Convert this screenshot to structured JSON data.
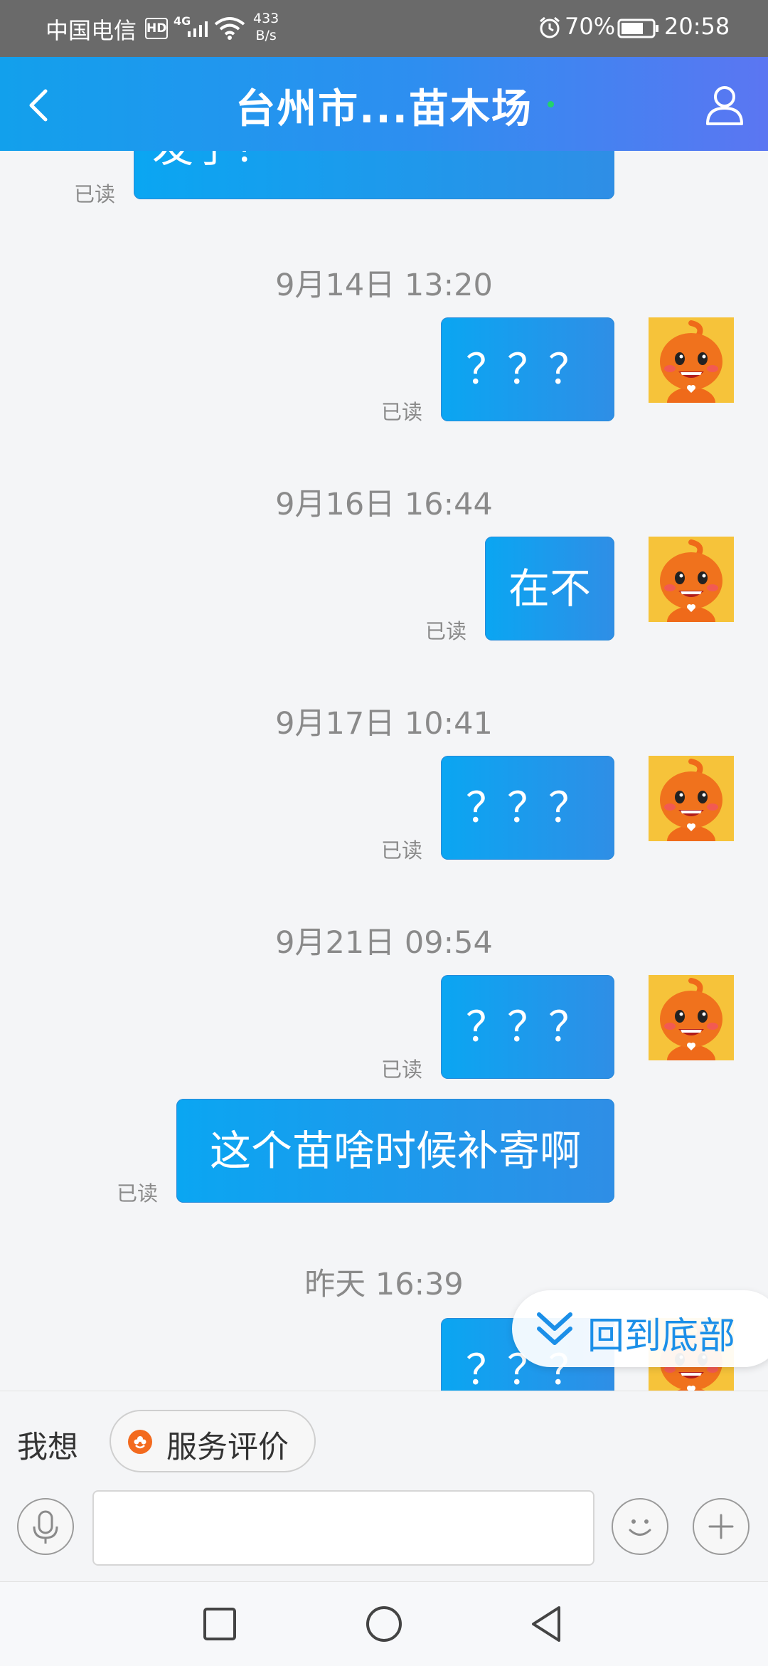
{
  "status_bar": {
    "carrier": "中国电信",
    "hd_badge": "HD",
    "network": "4G",
    "speed_value": "433",
    "speed_unit": "B/s",
    "battery_percent": "70%",
    "time": "20:58",
    "icons": [
      "signal-icon",
      "wifi-icon",
      "alarm-icon",
      "battery-icon"
    ]
  },
  "header": {
    "title": "台州市...苗木场",
    "back_icon": "chevron-left-icon",
    "profile_icon": "person-icon"
  },
  "chat": {
    "read_label": "已读",
    "messages": [
      {
        "timestamp": "",
        "text": "发了？",
        "read": "已读",
        "avatar_shown": false
      },
      {
        "timestamp": "9月14日 13:20",
        "text": "？？？",
        "read": "已读",
        "avatar_shown": true
      },
      {
        "timestamp": "9月16日 16:44",
        "text": "在不",
        "read": "已读",
        "avatar_shown": true
      },
      {
        "timestamp": "9月17日 10:41",
        "text": "？？？",
        "read": "已读",
        "avatar_shown": true
      },
      {
        "timestamp": "9月21日 09:54",
        "text": "？？？",
        "read": "已读",
        "avatar_shown": true
      },
      {
        "timestamp": "",
        "text": "这个苗啥时候补寄啊",
        "read": "已读",
        "avatar_shown": false
      },
      {
        "timestamp": "昨天 16:39",
        "text": "？？？",
        "read": "",
        "avatar_shown": true
      }
    ],
    "jump_to_bottom": "回到底部"
  },
  "quick_actions": {
    "prompt": "我想",
    "service_review": "服务评价"
  },
  "composer": {
    "input_value": "",
    "placeholder": "",
    "icons": [
      "microphone-icon",
      "emoji-icon",
      "plus-icon"
    ]
  },
  "nav_bar": {
    "icons": [
      "recent-apps-icon",
      "home-icon",
      "back-icon"
    ]
  },
  "colors": {
    "accent": "#1b8fe8",
    "bubble": "#1a9bea",
    "header_start": "#12a0ec",
    "header_end": "#5b76f2",
    "background": "#f4f5f7",
    "avatar_bg": "#f6c33a",
    "service_icon": "#f36a1e"
  }
}
